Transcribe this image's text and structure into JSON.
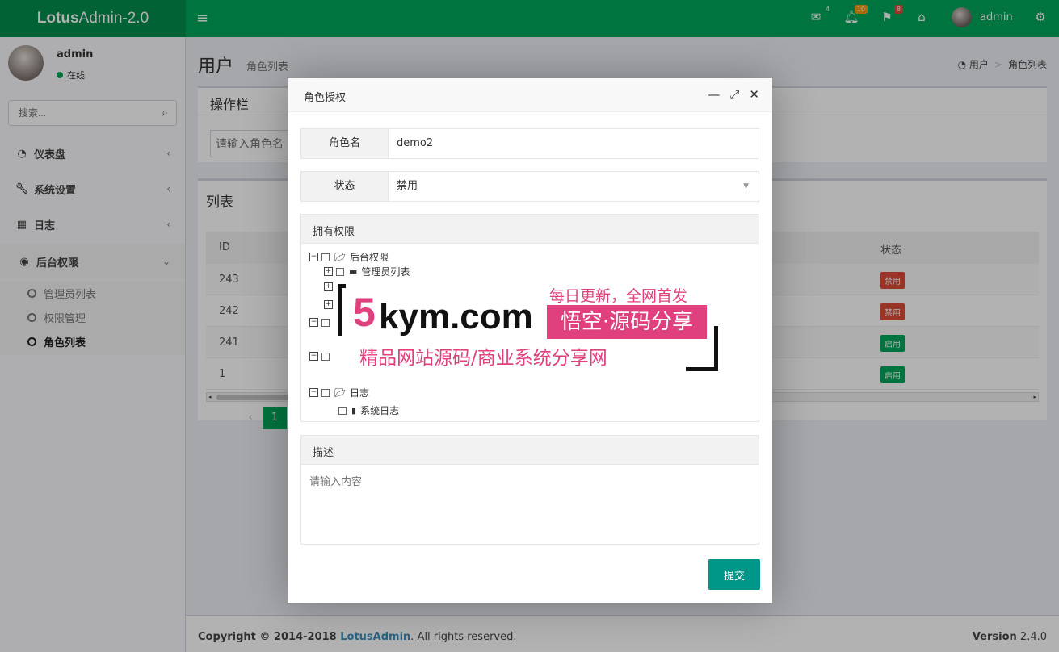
{
  "header": {
    "brand_bold": "Lotus",
    "brand_rest": "Admin-2.0",
    "badges": {
      "mail": "4",
      "bell": "10",
      "flag": "8"
    },
    "user": "admin"
  },
  "sidebar": {
    "user_name": "admin",
    "user_status": "在线",
    "search_placeholder": "搜索...",
    "menu": [
      {
        "label": "仪表盘",
        "icon": "dashboard-icon"
      },
      {
        "label": "系统设置",
        "icon": "wrench-icon"
      },
      {
        "label": "日志",
        "icon": "table-icon"
      },
      {
        "label": "后台权限",
        "icon": "user-circle-icon"
      }
    ],
    "submenu": [
      {
        "label": "管理员列表"
      },
      {
        "label": "权限管理"
      },
      {
        "label": "角色列表"
      }
    ]
  },
  "page": {
    "title": "用户",
    "subtitle": "角色列表",
    "breadcrumb": [
      "用户",
      "角色列表"
    ],
    "toolbar_title": "操作栏",
    "filter_placeholder": "请输入角色名",
    "list_title": "列表"
  },
  "table": {
    "columns": {
      "id": "ID",
      "status": "状态"
    },
    "rows": [
      {
        "id": "243",
        "status": "禁用",
        "enabled": false
      },
      {
        "id": "242",
        "status": "禁用",
        "enabled": false
      },
      {
        "id": "241",
        "status": "启用",
        "enabled": true
      },
      {
        "id": "1",
        "status": "启用",
        "enabled": true
      }
    ]
  },
  "pagination": {
    "current": "1"
  },
  "footer": {
    "copyright_prefix": "Copyright © 2014-2018 ",
    "brand_link": "LotusAdmin",
    "copyright_suffix": ". All rights reserved.",
    "version_label": "Version",
    "version_value": "2.4.0"
  },
  "modal": {
    "title": "角色授权",
    "role_label": "角色名",
    "role_value": "demo2",
    "status_label": "状态",
    "status_value": "禁用",
    "permissions_title": "拥有权限",
    "tree": {
      "root_a": "后台权限",
      "child_a1": "管理员列表",
      "root_c": "日志",
      "child_c1": "系统日志"
    },
    "desc_title": "描述",
    "desc_placeholder": "请输入内容",
    "submit_label": "提交"
  },
  "watermark": {
    "brand_digit": "5",
    "brand_text": "kym.com",
    "tagline_top": "每日更新，全网首发",
    "pill_text": "悟空·源码分享",
    "tagline_bottom": "精品网站源码/商业系统分享网"
  }
}
